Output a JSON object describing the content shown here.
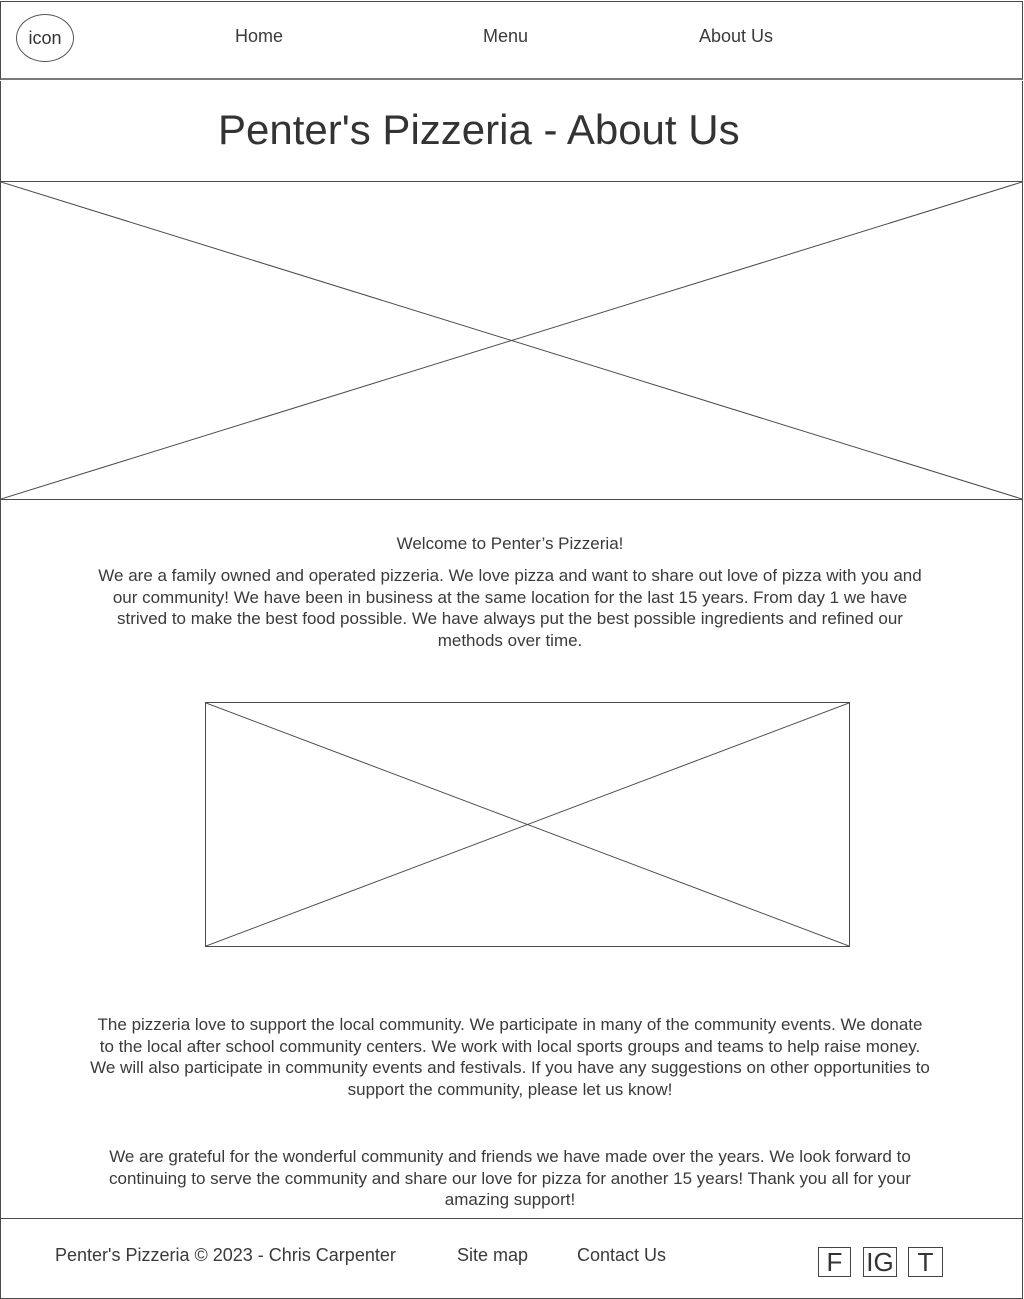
{
  "nav": {
    "logo_label": "icon",
    "links": [
      {
        "label": "Home"
      },
      {
        "label": "Menu"
      },
      {
        "label": "About Us"
      }
    ]
  },
  "header": {
    "title": "Penter's Pizzeria - About Us"
  },
  "main": {
    "welcome_heading": "Welcome to Penter’s Pizzeria!",
    "intro_paragraph": "We are a family owned and operated pizzeria. We love pizza and want to share out love of pizza with you and our community! We have been in business at the same location for the last 15 years. From day 1 we have strived to make the best food possible. We have always put the best possible ingredients and refined our methods over time.",
    "community_paragraph": "The pizzeria love to support the local community. We participate in many of the community events. We donate to the local after school community centers. We work with local sports groups and teams to help raise money. We will also participate in community events and festivals. If you have any suggestions on other opportunities to support the community, please let us know!",
    "thanks_paragraph": "We are grateful for the wonderful community and friends we have made over the years. We look forward to continuing to serve the community and share our love for pizza for another 15 years! Thank you all for your amazing support!"
  },
  "footer": {
    "copyright": "Penter's Pizzeria © 2023 - Chris Carpenter",
    "sitemap_label": "Site map",
    "contact_label": "Contact Us",
    "social": [
      {
        "label": "F",
        "icon": "facebook-icon"
      },
      {
        "label": "IG",
        "icon": "instagram-icon"
      },
      {
        "label": "T",
        "icon": "twitter-icon"
      }
    ]
  }
}
